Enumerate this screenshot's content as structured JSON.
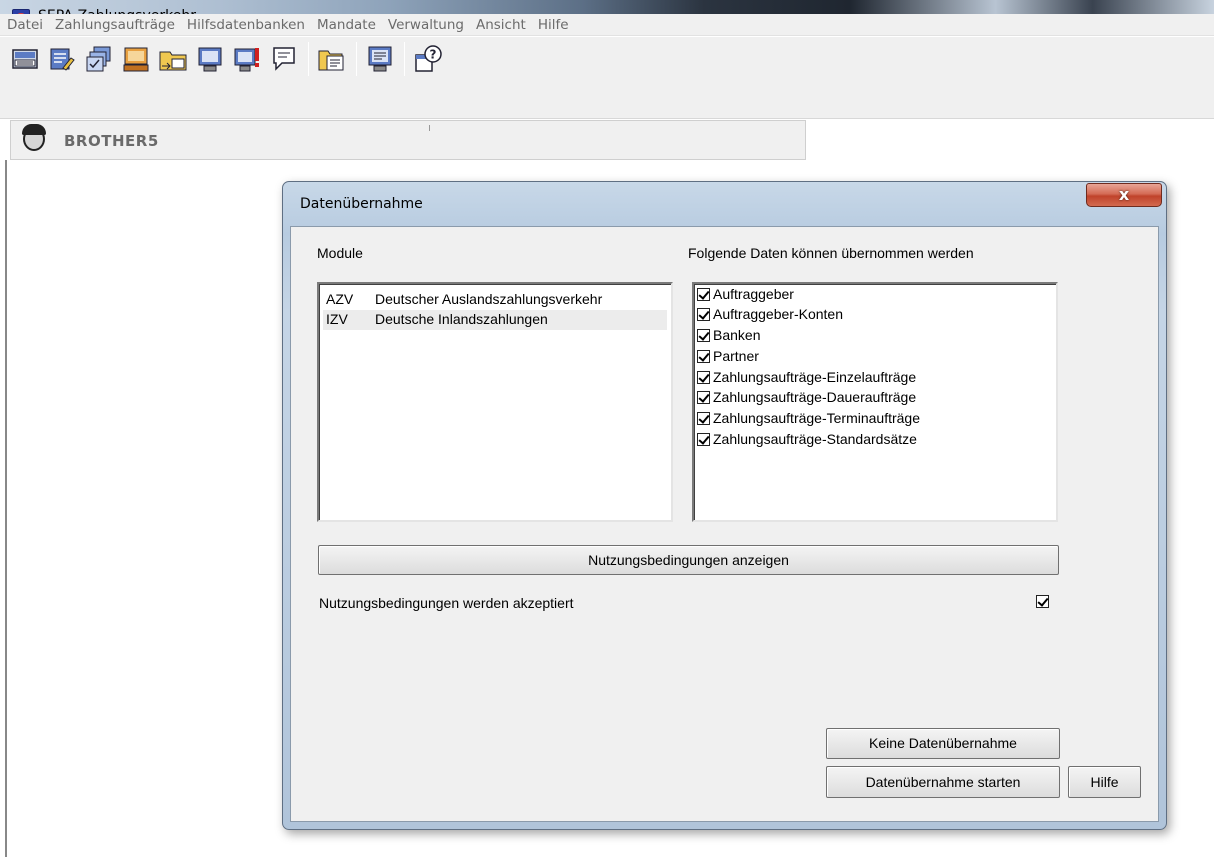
{
  "window": {
    "title": "SEPA-Zahlungsverkehr"
  },
  "menu": [
    "Datei",
    "Zahlungsaufträge",
    "Hilfsdatenbanken",
    "Mandate",
    "Verwaltung",
    "Ansicht",
    "Hilfe"
  ],
  "toolbar": {
    "icons": [
      "keyboard-icon",
      "edit-list-icon",
      "stacked-forms-icon",
      "terminal-icon",
      "folder-transfer-icon",
      "monitor-icon",
      "monitor-alert-icon",
      "speech-icon",
      "notes-folder-icon",
      "monitor-list-icon",
      "help-icon"
    ]
  },
  "user": {
    "name": "BROTHER5"
  },
  "dialog": {
    "title": "Datenübernahme",
    "modules_label": "Module",
    "modules": [
      {
        "code": "AZV",
        "name": "Deutscher Auslandszahlungsverkehr",
        "selected": false
      },
      {
        "code": "IZV",
        "name": "Deutsche Inlandszahlungen",
        "selected": true
      }
    ],
    "data_label": "Folgende Daten können übernommen werden",
    "data_items": [
      {
        "label": "Auftraggeber",
        "checked": true
      },
      {
        "label": "Auftraggeber-Konten",
        "checked": true
      },
      {
        "label": "Banken",
        "checked": true
      },
      {
        "label": "Partner",
        "checked": true
      },
      {
        "label": "Zahlungsaufträge-Einzelaufträge",
        "checked": true
      },
      {
        "label": "Zahlungsaufträge-Daueraufträge",
        "checked": true
      },
      {
        "label": "Zahlungsaufträge-Terminaufträge",
        "checked": true
      },
      {
        "label": "Zahlungsaufträge-Standardsätze",
        "checked": true
      }
    ],
    "terms_button": "Nutzungsbedingungen anzeigen",
    "terms_accept_label": "Nutzungsbedingungen werden akzeptiert",
    "terms_accepted": true,
    "no_import_button": "Keine Datenübernahme",
    "start_button": "Datenübernahme starten",
    "help_button": "Hilfe",
    "close_glyph": "x"
  },
  "colors": {
    "dialog_frame": "#b7cbe0",
    "close_button": "#c0432b",
    "menu_text": "#6b6b6b"
  }
}
